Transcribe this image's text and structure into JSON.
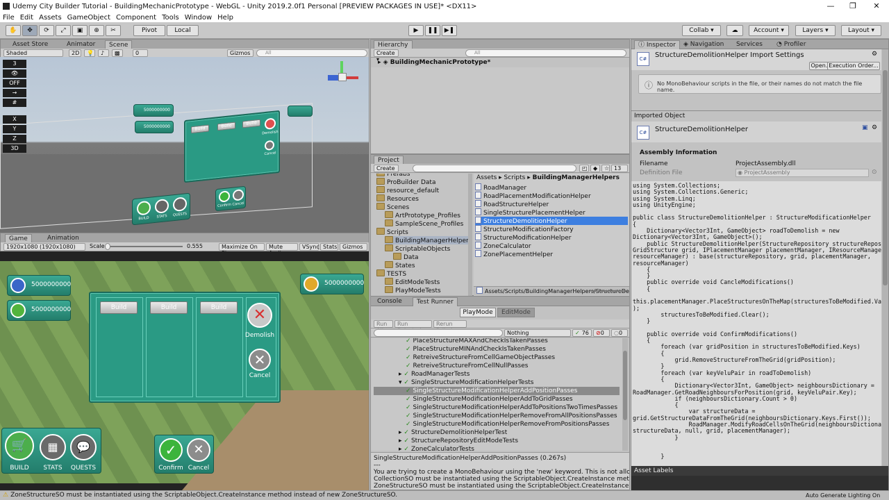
{
  "window": {
    "title": "Udemy City Builder Tutorial - BuildingMechanicPrototype - WebGL - Unity 2019.2.0f1 Personal [PREVIEW PACKAGES IN USE]* <DX11>",
    "min": "—",
    "max": "❐",
    "close": "✕"
  },
  "menu": [
    "File",
    "Edit",
    "Assets",
    "GameObject",
    "Component",
    "Tools",
    "Window",
    "Help"
  ],
  "toolbar": {
    "pivot": "Pivot",
    "local": "Local",
    "collab": "Collab ▾",
    "account": "Account",
    "layers": "Layers",
    "layout": "Layout"
  },
  "scene_tabs": {
    "asset_store": "Asset Store",
    "animator": "Animator",
    "scene": "Scene"
  },
  "scene_bar": {
    "shading": "Shaded",
    "mode2d": "2D",
    "gizmos": "Gizmos ▾",
    "search": "All",
    "fx_count": "0"
  },
  "scene_ui": {
    "badge_top": "5000000000",
    "badge_bottom": "5000000000",
    "money": "5000000000",
    "build": "Build",
    "demolish": "Demolish",
    "cancel": "Cancel",
    "menu_build": "BUILD",
    "menu_stats": "STATS",
    "menu_quests": "QUESTS",
    "confirm": "Confirm",
    "cancel2": "Cancel",
    "layer_num": "3",
    "off": "OFF",
    "mode3d": "3D"
  },
  "game_tabs": {
    "game": "Game",
    "animation": "Animation"
  },
  "game_bar": {
    "resolution": "1920x1080 (1920x1080)",
    "scale_label": "Scale",
    "scale_value": "0.555",
    "maximize": "Maximize On Play",
    "mute": "Mute Audio",
    "vsync": "VSync",
    "stats": "Stats",
    "gizmos": "Gizmos ▾"
  },
  "game_ui": {
    "pop_count": "5000000000",
    "happy_count": "5000000000",
    "money": "5000000000",
    "build_labels": [
      "Build",
      "Build",
      "Build"
    ],
    "demolish": "Demolish",
    "cancel": "Cancel",
    "bottom_build": "BUILD",
    "bottom_stats": "STATS",
    "bottom_quests": "QUESTS",
    "confirm": "Confirm",
    "cancel2": "Cancel"
  },
  "hierarchy": {
    "tab": "Hierarchy",
    "create": "Create ▾",
    "search": "All",
    "root": "BuildingMechanicPrototype*"
  },
  "playback": {
    "play": "▶",
    "pause": "❚❚",
    "step": "▶❚"
  },
  "project": {
    "tab": "Project",
    "create": "Create ▾",
    "count": "13",
    "tree": [
      {
        "label": "Prefabs",
        "indent": 0
      },
      {
        "label": "ProBuilder Data",
        "indent": 0
      },
      {
        "label": "resource_default",
        "indent": 0
      },
      {
        "label": "Resources",
        "indent": 0
      },
      {
        "label": "Scenes",
        "indent": 0
      },
      {
        "label": "ArtPrototype_Profiles",
        "indent": 1
      },
      {
        "label": "SampleScene_Profiles",
        "indent": 1
      },
      {
        "label": "Scripts",
        "indent": 0
      },
      {
        "label": "BuildingManagerHelpers",
        "indent": 1
      },
      {
        "label": "ScriptableObjects",
        "indent": 1
      },
      {
        "label": "Data",
        "indent": 2
      },
      {
        "label": "States",
        "indent": 1
      },
      {
        "label": "TESTS",
        "indent": 0
      },
      {
        "label": "EditModeTests",
        "indent": 1
      },
      {
        "label": "PlayModeTests",
        "indent": 1
      }
    ],
    "breadcrumb": {
      "a": "Assets",
      "b": "Scripts",
      "c": "BuildingManagerHelpers"
    },
    "files": [
      "RoadManager",
      "RoadPlacementModificationHelper",
      "RoadStructureHelper",
      "SingleStructurePlacementHelper",
      "StructureDemolitionHelper",
      "StructureModificationFactory",
      "StructureModificationHelper",
      "ZoneCalculator",
      "ZonePlacementHelper"
    ],
    "path": "Assets/Scripts/BuildingManagerHelpers/StructureDemolitionHelper.cs"
  },
  "console": {
    "console_tab": "Console",
    "runner_tab": "Test Runner",
    "playmode": "PlayMode",
    "editmode": "EditMode",
    "run_all": "Run All",
    "run_selected": "Run Selected",
    "rerun_failed": "Rerun Failed",
    "filter": "Nothing",
    "pass_count": "76",
    "fail_count": "0",
    "skip_count": "0",
    "tests": [
      {
        "label": "PlaceStructureMAXAndCheckIsTakenPasses",
        "indent": 2
      },
      {
        "label": "PlaceStructureMINAndCheckIsTakenPasses",
        "indent": 2
      },
      {
        "label": "RetreiveStructureFromCellGameObjectPasses",
        "indent": 2
      },
      {
        "label": "RetreiveStructureFromCellNullPasses",
        "indent": 2
      },
      {
        "label": "RoadManagerTests",
        "indent": 1
      },
      {
        "label": "SingleStructureModificationHelperTests",
        "indent": 1
      },
      {
        "label": "SingleStructureModificationHelperAddPositionPasses",
        "indent": 2
      },
      {
        "label": "SingleStructureModificationHelperAddToGridPasses",
        "indent": 2
      },
      {
        "label": "SingleStructureModificationHelperAddToPositionsTwoTimesPasses",
        "indent": 2
      },
      {
        "label": "SingleStructureModificationHelperRemoveFromAllPositionsPasses",
        "indent": 2
      },
      {
        "label": "SingleStructureModificationHelperRemoveFromPositionsPasses",
        "indent": 2
      },
      {
        "label": "StructureDemolitionHelperTest",
        "indent": 1
      },
      {
        "label": "StructureRepositoryEditModeTests",
        "indent": 1
      },
      {
        "label": "ZoneCalculatorTests",
        "indent": 1
      }
    ],
    "selected_index": 6,
    "details": [
      "SingleStructureModificationHelperAddPositionPasses (0.267s)",
      "---",
      "You are trying to create a MonoBehaviour using the 'new' keyword.  This is not allo",
      "CollectionSO must be instantiated using the ScriptableObject.CreateInstance meth",
      "ZoneStructureSO must be instantiated using the ScriptableObject.CreateInstance me"
    ]
  },
  "inspector": {
    "tabs": [
      "Inspector",
      "Navigation",
      "Services",
      "Profiler"
    ],
    "header": "StructureDemolitionHelper Import Settings",
    "open": "Open...",
    "exec_order": "Execution Order...",
    "warning": "No MonoBehaviour scripts in the file, or their names do not match the file name.",
    "imported_object": "Imported Object",
    "object_name": "StructureDemolitionHelper",
    "assembly_info": "Assembly Information",
    "filename_label": "Filename",
    "filename_value": "ProjectAssembly.dll",
    "definition_label": "Definition File",
    "definition_value": "ProjectAssembly",
    "code": [
      "using System.Collections;",
      "using System.Collections.Generic;",
      "using System.Linq;",
      "using UnityEngine;",
      "",
      "public class StructureDemolitionHelper : StructureModificationHelper",
      "{",
      "    Dictionary<Vector3Int, GameObject> roadToDemolish = new",
      "Dictionary<Vector3Int, GameObject>();",
      "    public StructureDemolitionHelper(StructureRepository structureRepository,",
      "GridStructure grid, IPlacementManager placementManager, IResourceManager",
      "resourceManager) : base(structureRepository, grid, placementManager,",
      "resourceManager)",
      "    {",
      "    }",
      "    public override void CancleModifications()",
      "    {",
      "",
      "this.placementManager.PlaceStructuresOnTheMap(structuresToBeModified.Values",
      ");",
      "        structuresToBeModified.Clear();",
      "    }",
      "",
      "    public override void ConfirmModifications()",
      "    {",
      "        foreach (var gridPosition in structuresToBeModified.Keys)",
      "        {",
      "            grid.RemoveStructureFromTheGrid(gridPosition);",
      "        }",
      "        foreach (var keyVeluPair in roadToDemolish)",
      "        {",
      "            Dictionary<Vector3Int, GameObject> neighboursDictionary =",
      "RoadManager.GetRoadNeighboursForPosition(grid, keyVeluPair.Key);",
      "            if (neighboursDictionary.Count > 0)",
      "            {",
      "                var structureData =",
      "grid.GetStructureDataFromTheGrid(neighboursDictionary.Keys.First());",
      "                RoadManager.ModifyRoadCellsOnTheGrid(neighboursDictionary,",
      "structureData, null, grid, placementManager);",
      "            }",
      "",
      "",
      "        }"
    ],
    "asset_labels": "Asset Labels"
  },
  "status": {
    "message": "ZoneStructureSO must be instantiated using the ScriptableObject.CreateInstance method instead of new ZoneStructureSO.",
    "right": "Auto Generate Lighting On"
  },
  "colors": {
    "selection": "#3d7fe0",
    "teal": "#2a9a84",
    "pass": "#2a8a1e"
  }
}
